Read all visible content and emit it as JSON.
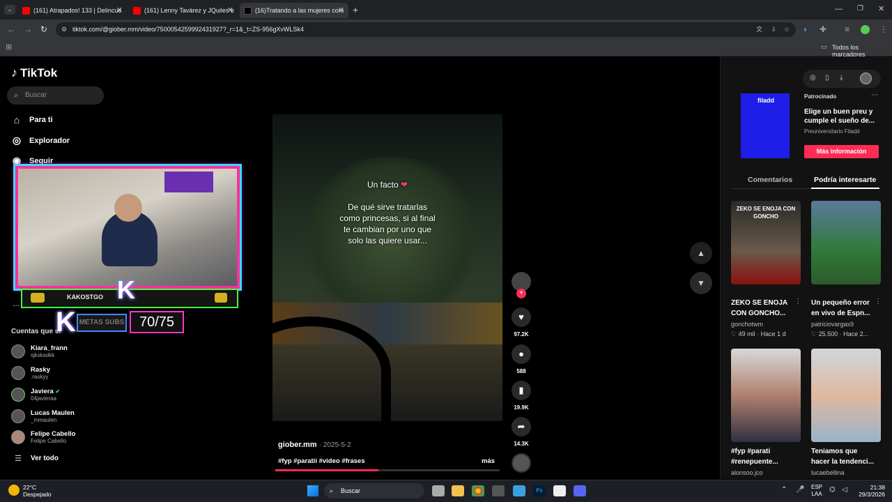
{
  "browser": {
    "tabs": [
      {
        "title": "(161) Atrapados! 133 | Delincue",
        "color": "#ff0000"
      },
      {
        "title": "(161) Lenny Tavárez y JQuiles e",
        "color": "#ff0000"
      },
      {
        "title": "(16)Tratando a las mujeres com",
        "color": "#111111"
      }
    ],
    "url": "tiktok.com/@giober.mm/video/7500054259992431927?_r=1&_t=ZS-956gXvWLSk4",
    "bookmarks_label": "Todos los marcadores"
  },
  "tiktok": {
    "logo": "TikTok",
    "search_placeholder": "Buscar",
    "nav": [
      {
        "label": "Para ti",
        "icon": "home-icon"
      },
      {
        "label": "Explorador",
        "icon": "compass-icon"
      },
      {
        "label": "Seguir",
        "icon": "following-icon"
      }
    ],
    "following_title": "Cuentas que si",
    "accounts": [
      {
        "name": "Kiara_frann",
        "user": "sjksksdkk"
      },
      {
        "name": "Rasky",
        "user": ".raskyy"
      },
      {
        "name": "Javiera",
        "user": "04javieraa",
        "verified": true
      },
      {
        "name": "Lucas Maulen",
        "user": "_mmaulen"
      },
      {
        "name": "Felipe Cabello",
        "user": "Felipe Cabello"
      }
    ],
    "see_all": "Ver todo",
    "more_dots": "...",
    "stream": {
      "name": "KAKOSTGO",
      "subs_label": "METAS SUBS",
      "subs_count": "70/75",
      "k": "K"
    },
    "video": {
      "line1": "Un facto",
      "line2": "De qué sirve tratarlas",
      "line3": "como princesas, si al final",
      "line4": "te cambian por uno que",
      "line5": "solo las quiere usar...",
      "author": "giober.mm",
      "date": "· 2025-5-2",
      "tags": "#fyp #paratii #video #frases",
      "more": "más",
      "progress": 0.46
    },
    "actions": {
      "likes": "97.2K",
      "comments": "588",
      "saves": "19.9K",
      "shares": "14.3K"
    },
    "ad": {
      "sponsored": "Patrocinado",
      "title1": "Elige un buen preu y",
      "title2": "cumple el sueño de...",
      "advertiser": "Preuniversitario Filadd",
      "cta": "Más información",
      "brand": "filadd"
    },
    "tabs": {
      "comments": "Comentarios",
      "related": "Podría interesarte"
    },
    "cards": [
      {
        "thumb_text": "ZEKO SE ENOJA CON GONCHO",
        "title1": "ZEKO SE ENOJA",
        "title2": "CON GONCHO...",
        "author": "gonchotwm",
        "meta": "♡ 49 mil · Hace 1 d"
      },
      {
        "thumb_text": "",
        "title1": "Un pequeño error",
        "title2": "en vivo de Espn...",
        "author": "patriciovargas9",
        "meta": "♡ 25.500 · Hace 2..."
      },
      {
        "thumb_text": "",
        "title1": "#fyp #parati",
        "title2": "#renepuente...",
        "author": "alonsoo.jco",
        "meta": ""
      },
      {
        "thumb_text": "",
        "title1": "Teniamos que",
        "title2": "hacer la tendenci...",
        "author": "lucaebellina",
        "meta": ""
      }
    ]
  },
  "taskbar": {
    "weather_temp": "22°C",
    "weather_desc": "Despejado",
    "search": "Buscar",
    "lang1": "ESP",
    "lang2": "LAA",
    "time": "21:38",
    "date": "29/3/2026"
  }
}
